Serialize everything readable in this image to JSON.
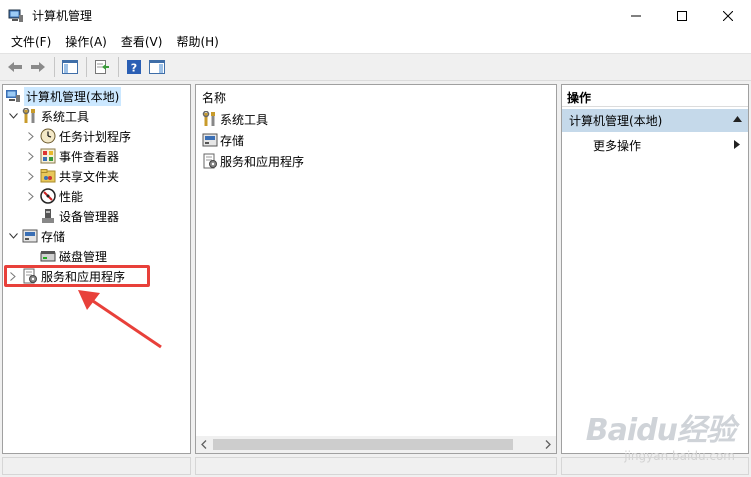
{
  "window": {
    "title": "计算机管理"
  },
  "menu": {
    "items": [
      "文件(F)",
      "操作(A)",
      "查看(V)",
      "帮助(H)"
    ]
  },
  "toolbar": {
    "icons": [
      "back-icon",
      "forward-icon",
      "show-hide-console-tree-icon",
      "export-list-icon",
      "help-icon",
      "show-hide-action-pane-icon"
    ]
  },
  "tree": {
    "root": "计算机管理(本地)",
    "system_tools": "系统工具",
    "task_scheduler": "任务计划程序",
    "event_viewer": "事件查看器",
    "shared_folders": "共享文件夹",
    "performance": "性能",
    "device_manager": "设备管理器",
    "storage": "存储",
    "disk_management": "磁盘管理",
    "services_apps": "服务和应用程序"
  },
  "content": {
    "column_header": "名称",
    "items": [
      "系统工具",
      "存储",
      "服务和应用程序"
    ]
  },
  "actions": {
    "header": "操作",
    "section": "计算机管理(本地)",
    "more": "更多操作"
  },
  "watermark": {
    "main": "Baidu经验",
    "sub": "jingyan.baidu.com"
  },
  "colors": {
    "selection": "#cce8ff",
    "action_section": "#c5d9ea",
    "highlight": "#e8403a"
  }
}
